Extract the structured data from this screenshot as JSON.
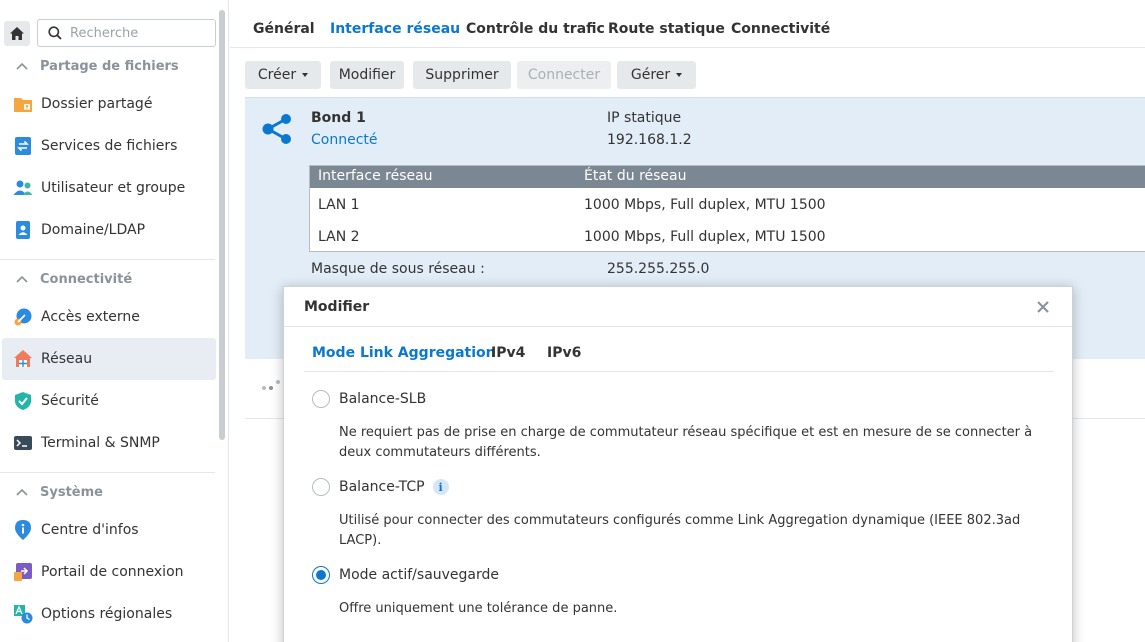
{
  "sidebar": {
    "search_placeholder": "Recherche",
    "sections": [
      {
        "title": "Partage de fichiers"
      },
      {
        "title": "Connectivité"
      },
      {
        "title": "Système"
      }
    ],
    "items": [
      {
        "label": "Dossier partagé",
        "icon": "shared-folder-icon"
      },
      {
        "label": "Services de fichiers",
        "icon": "file-services-icon"
      },
      {
        "label": "Utilisateur et groupe",
        "icon": "user-group-icon"
      },
      {
        "label": "Domaine/LDAP",
        "icon": "domain-ldap-icon"
      },
      {
        "label": "Accès externe",
        "icon": "external-access-icon"
      },
      {
        "label": "Réseau",
        "icon": "network-icon",
        "active": true
      },
      {
        "label": "Sécurité",
        "icon": "security-shield-icon"
      },
      {
        "label": "Terminal & SNMP",
        "icon": "terminal-icon"
      },
      {
        "label": "Centre d'infos",
        "icon": "info-center-icon"
      },
      {
        "label": "Portail de connexion",
        "icon": "login-portal-icon"
      },
      {
        "label": "Options régionales",
        "icon": "regional-options-icon"
      }
    ]
  },
  "tabs": [
    "Général",
    "Interface réseau",
    "Contrôle du trafic",
    "Route statique",
    "Connectivité"
  ],
  "active_tab": "Interface réseau",
  "toolbar": {
    "create": "Créer",
    "modify": "Modifier",
    "delete": "Supprimer",
    "connect": "Connecter",
    "manage": "Gérer"
  },
  "bond": {
    "name": "Bond 1",
    "status": "Connecté",
    "ip_mode": "IP statique",
    "ip": "192.168.1.2",
    "table": {
      "headers": [
        "Interface réseau",
        "État du réseau"
      ],
      "rows": [
        [
          "LAN 1",
          "1000 Mbps, Full duplex, MTU 1500"
        ],
        [
          "LAN 2",
          "1000 Mbps, Full duplex, MTU 1500"
        ]
      ]
    },
    "mask_label": "Masque de sous réseau :",
    "mask_value": "255.255.255.0"
  },
  "modal": {
    "title": "Modifier",
    "tabs": [
      "Mode Link Aggregation",
      "IPv4",
      "IPv6"
    ],
    "active_tab": "Mode Link Aggregation",
    "options": [
      {
        "label": "Balance-SLB",
        "checked": false,
        "info": false,
        "desc": "Ne requiert pas de prise en charge de commutateur réseau spécifique et est en mesure de se connecter à deux commutateurs différents."
      },
      {
        "label": "Balance-TCP",
        "checked": false,
        "info": true,
        "desc": "Utilisé pour connecter des commutateurs configurés comme Link Aggregation dynamique (IEEE 802.3ad LACP)."
      },
      {
        "label": "Mode actif/sauvegarde",
        "checked": true,
        "info": false,
        "desc": "Offre uniquement une tolérance de panne."
      }
    ],
    "info_glyph": "i"
  },
  "colors": {
    "accent": "#0b78d0",
    "selected_panel": "#e3edf7",
    "table_header": "#7b8793"
  }
}
